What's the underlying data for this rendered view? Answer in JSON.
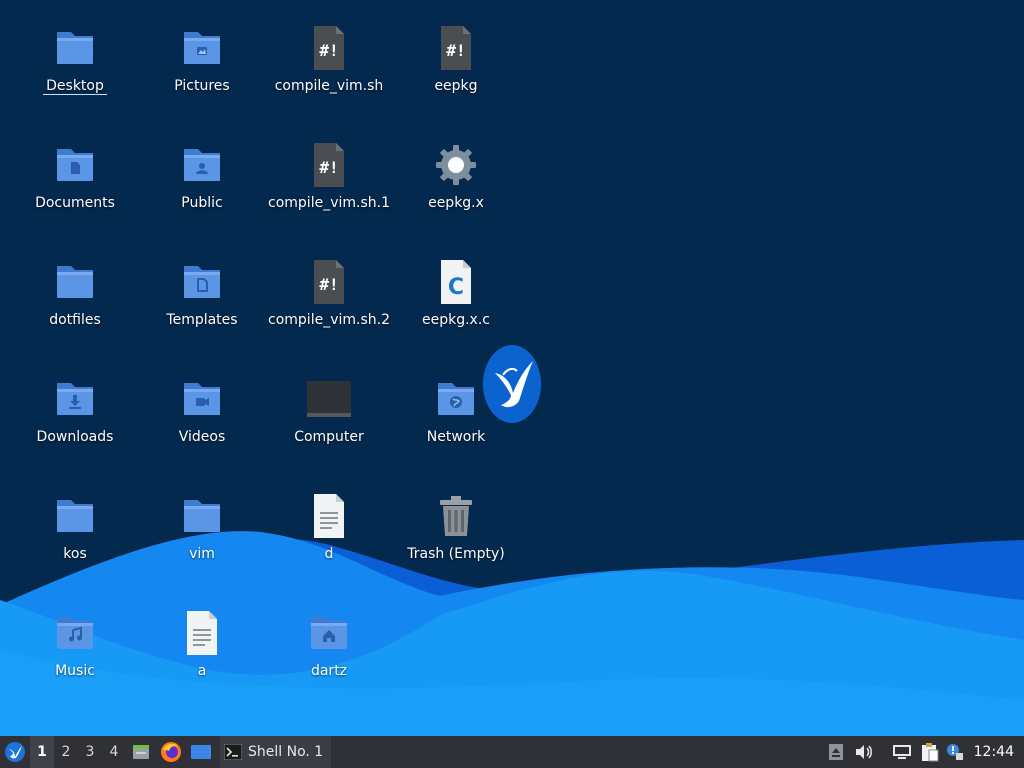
{
  "colors": {
    "desktop_bg": "#03294f",
    "folder_body": "#5b95e6",
    "folder_tab": "#3f7bd1",
    "taskbar_bg": "#2f3136",
    "wave_light": "#169af6",
    "wave_dark": "#0b5fd6"
  },
  "desktop_icons": [
    {
      "label": "Desktop",
      "icon": "folder-icon"
    },
    {
      "label": "Pictures",
      "icon": "folder-pictures-icon"
    },
    {
      "label": "compile_vim.sh",
      "icon": "shell-script-icon"
    },
    {
      "label": "eepkg",
      "icon": "shell-script-icon"
    },
    {
      "label": "Documents",
      "icon": "folder-documents-icon"
    },
    {
      "label": "Public",
      "icon": "folder-public-icon"
    },
    {
      "label": "compile_vim.sh.1",
      "icon": "shell-script-icon"
    },
    {
      "label": "eepkg.x",
      "icon": "executable-gear-icon"
    },
    {
      "label": "dotfiles",
      "icon": "folder-icon"
    },
    {
      "label": "Templates",
      "icon": "folder-templates-icon"
    },
    {
      "label": "compile_vim.sh.2",
      "icon": "shell-script-icon"
    },
    {
      "label": "eepkg.x.c",
      "icon": "c-source-file-icon"
    },
    {
      "label": "Downloads",
      "icon": "folder-downloads-icon"
    },
    {
      "label": "Videos",
      "icon": "folder-videos-icon"
    },
    {
      "label": "Computer",
      "icon": "computer-icon"
    },
    {
      "label": "Network",
      "icon": "folder-network-icon"
    },
    {
      "label": "kos",
      "icon": "folder-icon"
    },
    {
      "label": "vim",
      "icon": "folder-icon"
    },
    {
      "label": "d",
      "icon": "text-file-icon"
    },
    {
      "label": "Trash (Empty)",
      "icon": "trash-icon"
    },
    {
      "label": "Music",
      "icon": "folder-music-icon"
    },
    {
      "label": "a",
      "icon": "text-file-icon"
    },
    {
      "label": "dartz",
      "icon": "folder-home-icon"
    }
  ],
  "taskbar": {
    "menu_icon": "lubuntu-bird-icon",
    "workspaces": [
      "1",
      "2",
      "3",
      "4"
    ],
    "active_workspace": "1",
    "launchers": [
      "file-manager-icon",
      "firefox-icon",
      "show-desktop-icon"
    ],
    "task_label": "Shell No. 1",
    "task_icon": "terminal-icon",
    "tray_icons": [
      "eject-icon",
      "volume-icon",
      "network-icon",
      "clipboard-icon",
      "update-notifier-icon"
    ],
    "clock": "12:44"
  }
}
